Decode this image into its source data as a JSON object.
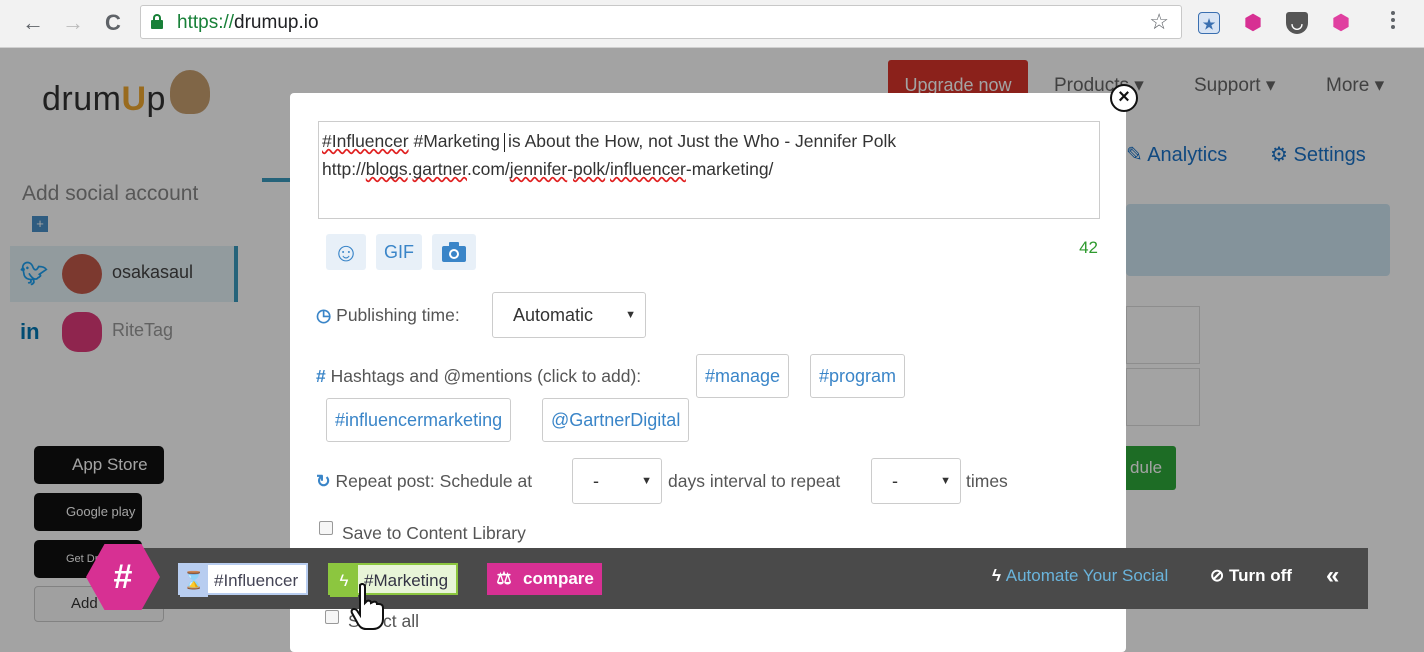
{
  "browser": {
    "back": "←",
    "forward": "→",
    "reload": "C",
    "url_scheme": "https://",
    "url_host": "drumup.io",
    "star": "☆",
    "extensions": [
      {
        "name": "bookmark-extension-icon",
        "glyph": "★",
        "color": "#3a6fb0"
      },
      {
        "name": "riteTag-extension-icon",
        "glyph": "⬢",
        "color": "#d73093"
      },
      {
        "name": "pocket-extension-icon",
        "glyph": "◡",
        "color": "#555555"
      },
      {
        "name": "pink-hex-extension-icon",
        "glyph": "⬢",
        "color": "#e040a0"
      }
    ]
  },
  "page": {
    "logo_pre": "drum",
    "logo_u": "U",
    "logo_post": "p",
    "upgrade_label": "Upgrade now",
    "nav": [
      "Products ▾",
      "Support ▾",
      "More ▾"
    ],
    "subnav": [
      "Analytics",
      "Settings"
    ],
    "add_social": "Add social account",
    "accounts": [
      {
        "net": "twitter",
        "name": "osakasaul"
      },
      {
        "net": "linkedin",
        "name": "RiteTag"
      }
    ],
    "app_store": "App Store",
    "google_play": "Google play",
    "chrome": "Get Drum Chrome",
    "add_slack": "Add",
    "schedule_btn": "dule"
  },
  "modal": {
    "text_hashtag1": "#Influencer",
    "text_hashtag2": "#Marketing",
    "text_rest": "is About the How, not Just the Who - Jennifer Polk",
    "link_parts": [
      "http://",
      "blogs",
      ".",
      "gartner",
      ".com/",
      "jennifer",
      "-",
      "polk",
      "/",
      "influencer",
      "-marketing/"
    ],
    "tools": {
      "emoji": "☺",
      "gif": "GIF",
      "photo": "photo"
    },
    "char_count": "42",
    "publishing_label": "Publishing time:",
    "publishing_value": "Automatic",
    "hashtags_label": "Hashtags and @mentions (click to add):",
    "suggestions": [
      "#manage",
      "#program",
      "#influencermarketing",
      "@GartnerDigital"
    ],
    "repeat_label": "Repeat post: Schedule at",
    "repeat_days_value": "-",
    "repeat_mid": "days interval to repeat",
    "repeat_times_value": "-",
    "repeat_end": "times",
    "save_library": "Save to Content Library",
    "select_all": "Select all"
  },
  "ritetag": {
    "hex_label": "#",
    "tags": [
      {
        "label": "#Influencer",
        "color": "#b8cdf0",
        "bg": "#ffffff",
        "icon": "⌛"
      },
      {
        "label": "#Marketing",
        "color": "#8cc63f",
        "bg": "#e8f5d8",
        "icon": "ϟ"
      }
    ],
    "compare": "compare",
    "automate": "Automate Your Social",
    "turn_off": "Turn off",
    "collapse": "«"
  }
}
